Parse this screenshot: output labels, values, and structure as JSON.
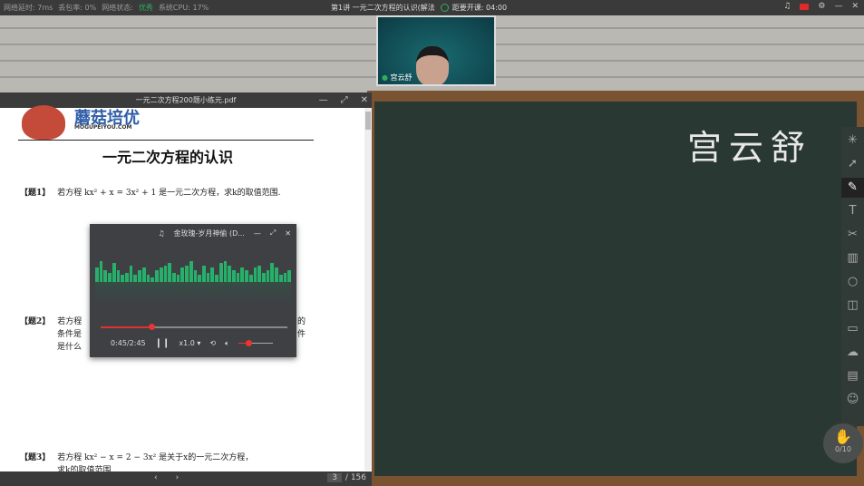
{
  "topbar": {
    "latency": "网络延时: 7ms",
    "loss": "丢包率: 0%",
    "net_label": "网络状态:",
    "net_value": "优秀",
    "cpu": "系统CPU: 17%",
    "lesson_title": "第1讲 一元二次方程的认识(解法",
    "countdown": "距要开课: 04:00"
  },
  "camera": {
    "name": "宫云舒"
  },
  "board": {
    "handwriting": "宫云舒",
    "tools": [
      "laser-pointer",
      "select",
      "pen",
      "text",
      "scissors",
      "eraser",
      "shapes",
      "whiteboard",
      "chat",
      "cloud",
      "toolbox",
      "students"
    ],
    "selected_tool": "pen",
    "hand_count": "0/10"
  },
  "pdf": {
    "title": "一元二次方程200题小练元.pdf",
    "brand": "蘑菇培优",
    "brand_url": "MOGUPEIYOU.COM",
    "heading": "一元二次方程的认识",
    "q1_label": "【题1】",
    "q1": "若方程 kx² + x = 3x² + 1 是一元二次方程，求k的取值范围.",
    "q2_label": "【题2】",
    "q2_l1": "若方程",
    "q2_l1_end": "的",
    "q2_l2": "条件是",
    "q2_l2_end": "件",
    "q2_l3": "是什么",
    "q3_label": "【题3】",
    "q3": "若方程 kx² − x = 2 − 3x² 是关于x的一元二次方程，",
    "q3_l2": "求k的取值范围.",
    "page_current": "3",
    "page_total": "/ 156",
    "prev": "‹",
    "next": "›"
  },
  "player": {
    "title": "金玫瑰-岁月神偷 (D...",
    "time": "0:45/2:45",
    "speed": "x1.0",
    "progress": 0.27,
    "volume": 0.3,
    "accent": "#e33333",
    "eq_color": "#27b06a"
  }
}
